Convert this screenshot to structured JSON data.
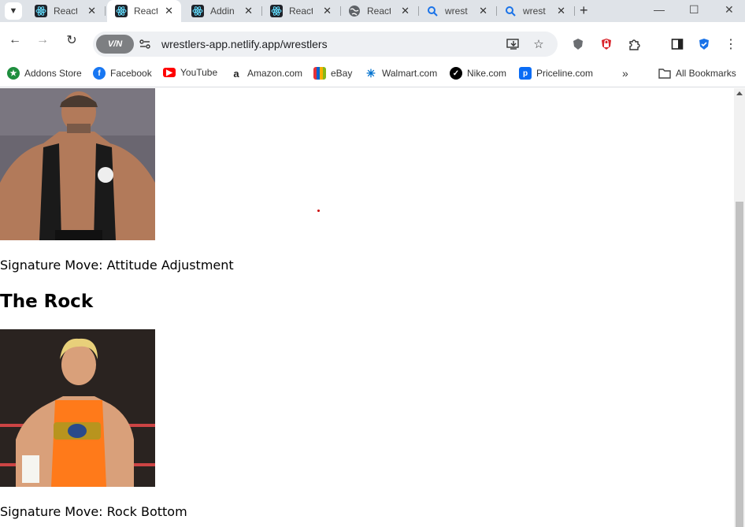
{
  "tabs": [
    {
      "title": "React",
      "icon": "react-icon",
      "active": false
    },
    {
      "title": "React",
      "icon": "react-icon",
      "active": true
    },
    {
      "title": "Adding",
      "icon": "react-icon",
      "active": false
    },
    {
      "title": "React",
      "icon": "react-icon",
      "active": false
    },
    {
      "title": "React",
      "icon": "globe-icon",
      "active": false
    },
    {
      "title": "wrest",
      "icon": "search-icon",
      "active": false
    },
    {
      "title": "wrest",
      "icon": "search-icon",
      "active": false
    }
  ],
  "toolbar": {
    "vpn_label": "V/N",
    "url": "wrestlers-app.netlify.app/wrestlers"
  },
  "bookmarks": [
    {
      "label": "Addons Store",
      "icon": "addons-store-icon",
      "color": "#1e8e3e"
    },
    {
      "label": "Facebook",
      "icon": "facebook-icon",
      "color": "#1877f2"
    },
    {
      "label": "YouTube",
      "icon": "youtube-icon",
      "color": "#ff0000"
    },
    {
      "label": "Amazon.com",
      "icon": "amazon-icon",
      "color": "#222222"
    },
    {
      "label": "eBay",
      "icon": "ebay-icon",
      "color": "#222222"
    },
    {
      "label": "Walmart.com",
      "icon": "walmart-icon",
      "color": "#0071ce"
    },
    {
      "label": "Nike.com",
      "icon": "nike-icon",
      "color": "#000000"
    },
    {
      "label": "Priceline.com",
      "icon": "priceline-icon",
      "color": "#0a6cf5"
    }
  ],
  "all_bookmarks_label": "All Bookmarks",
  "wrestlers": [
    {
      "signature": "Signature Move: Attitude Adjustment"
    },
    {
      "name": "The Rock",
      "signature": "Signature Move: Rock Bottom"
    }
  ]
}
